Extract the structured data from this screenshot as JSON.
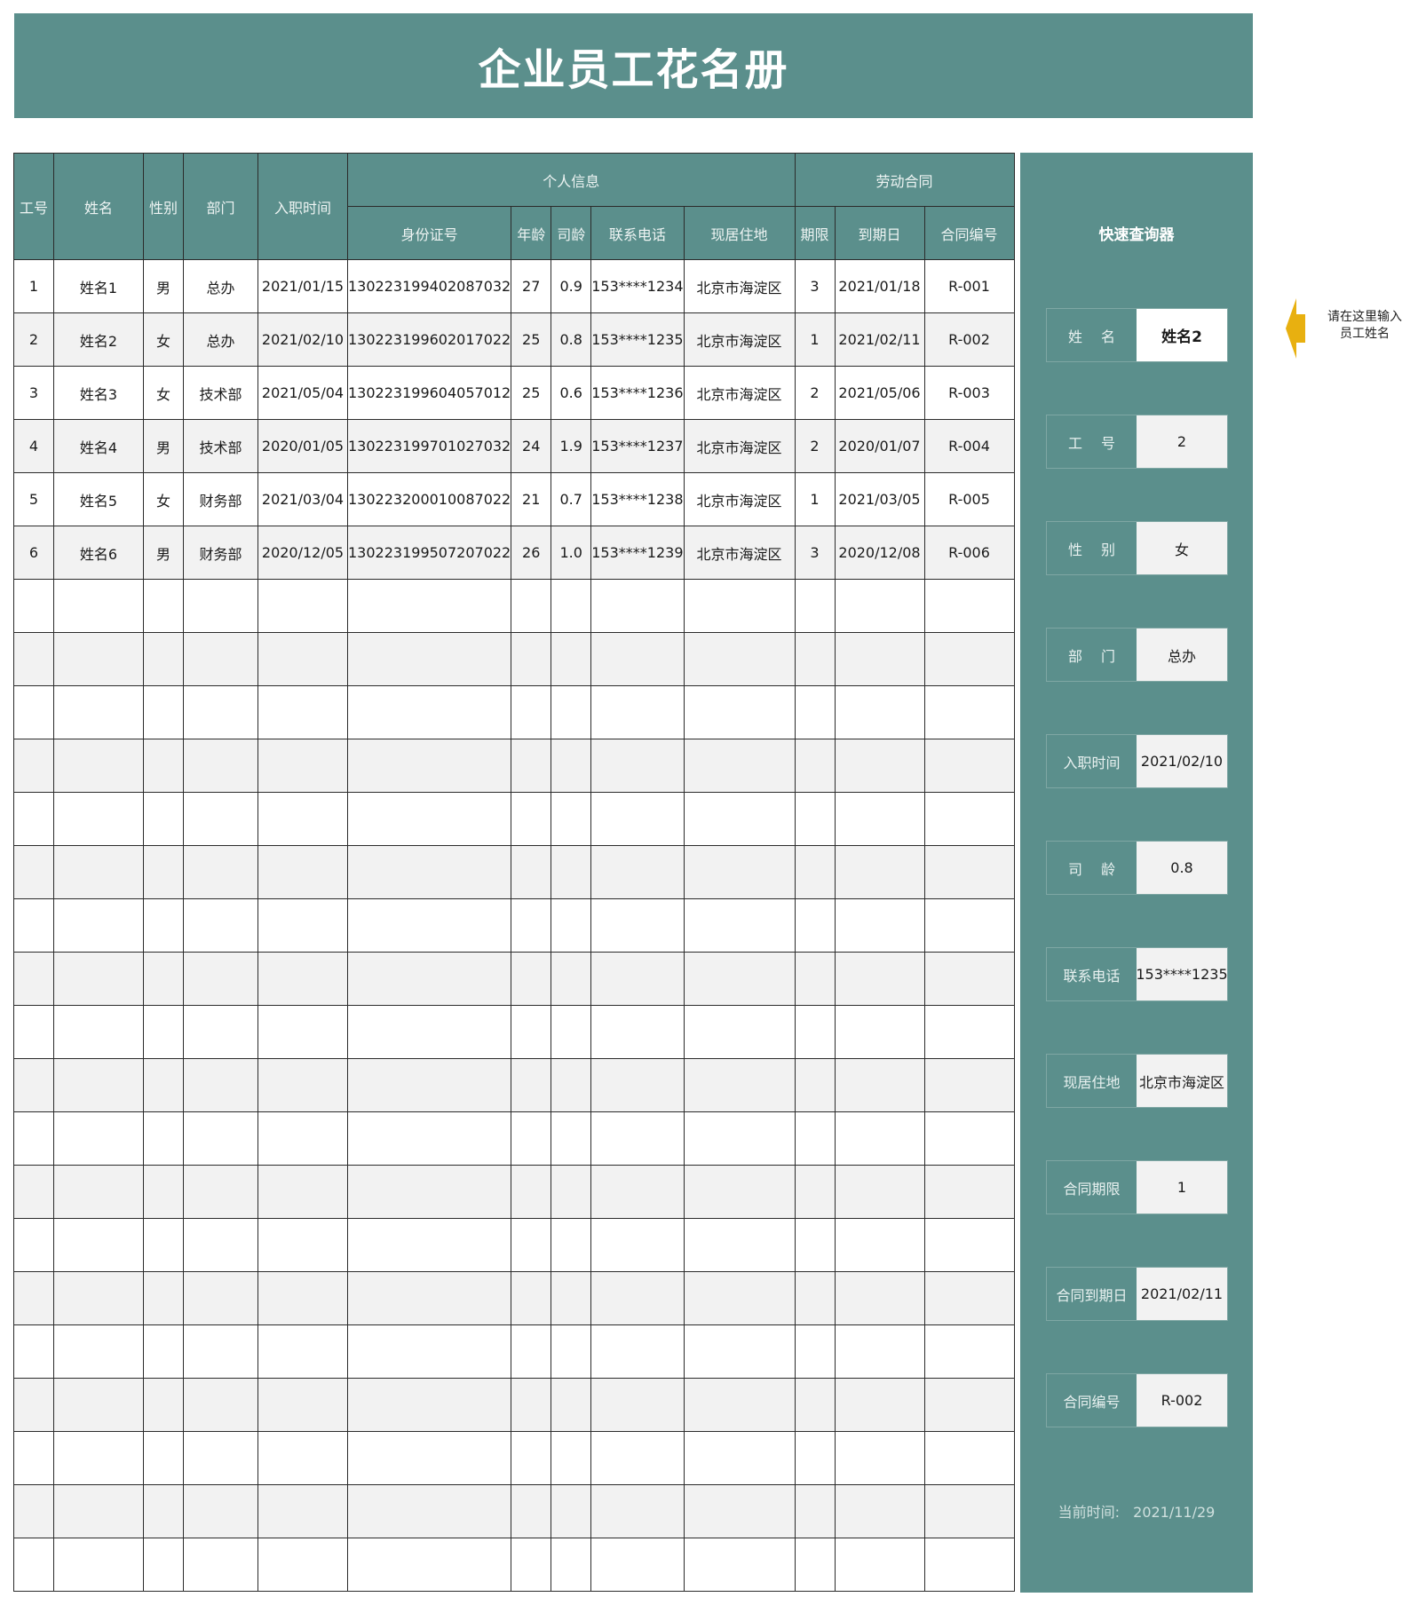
{
  "title": "企业员工花名册",
  "table": {
    "headers": {
      "emp_id": "工号",
      "name": "姓名",
      "gender": "性别",
      "dept": "部门",
      "join_date": "入职时间",
      "personal_group": "个人信息",
      "contract_group": "劳动合同",
      "id_number": "身份证号",
      "age": "年龄",
      "tenure": "司龄",
      "phone": "联系电话",
      "address": "现居住地",
      "term": "期限",
      "expiry": "到期日",
      "contract_no": "合同编号"
    },
    "rows": [
      [
        "1",
        "姓名1",
        "男",
        "总办",
        "2021/01/15",
        "130223199402087032",
        "27",
        "0.9",
        "153****1234",
        "北京市海淀区",
        "3",
        "2021/01/18",
        "R-001"
      ],
      [
        "2",
        "姓名2",
        "女",
        "总办",
        "2021/02/10",
        "130223199602017022",
        "25",
        "0.8",
        "153****1235",
        "北京市海淀区",
        "1",
        "2021/02/11",
        "R-002"
      ],
      [
        "3",
        "姓名3",
        "女",
        "技术部",
        "2021/05/04",
        "130223199604057012",
        "25",
        "0.6",
        "153****1236",
        "北京市海淀区",
        "2",
        "2021/05/06",
        "R-003"
      ],
      [
        "4",
        "姓名4",
        "男",
        "技术部",
        "2020/01/05",
        "130223199701027032",
        "24",
        "1.9",
        "153****1237",
        "北京市海淀区",
        "2",
        "2020/01/07",
        "R-004"
      ],
      [
        "5",
        "姓名5",
        "女",
        "财务部",
        "2021/03/04",
        "130223200010087022",
        "21",
        "0.7",
        "153****1238",
        "北京市海淀区",
        "1",
        "2021/03/05",
        "R-005"
      ],
      [
        "6",
        "姓名6",
        "男",
        "财务部",
        "2020/12/05",
        "130223199507207022",
        "26",
        "1.0",
        "153****1239",
        "北京市海淀区",
        "3",
        "2020/12/08",
        "R-006"
      ]
    ],
    "empty_rows": 19
  },
  "query": {
    "title": "快速查询器",
    "fields": [
      {
        "label": "姓　 名",
        "value": "姓名2",
        "input": true
      },
      {
        "label": "工　 号",
        "value": "2"
      },
      {
        "label": "性　 别",
        "value": "女"
      },
      {
        "label": "部　 门",
        "value": "总办"
      },
      {
        "label": "入职时间",
        "value": "2021/02/10"
      },
      {
        "label": "司　 龄",
        "value": "0.8"
      },
      {
        "label": "联系电话",
        "value": "153****1235"
      },
      {
        "label": "现居住地",
        "value": "北京市海淀区"
      },
      {
        "label": "合同期限",
        "value": "1"
      },
      {
        "label": "合同到期日",
        "value": "2021/02/11"
      },
      {
        "label": "合同编号",
        "value": "R-002"
      }
    ],
    "current_time_label": "当前时间:",
    "current_time_value": "2021/11/29"
  },
  "hint": {
    "line1": "请在这里输入",
    "line2": "员工姓名"
  },
  "colors": {
    "header_bg": "#5b8f8c",
    "arrow": "#e8b010"
  }
}
